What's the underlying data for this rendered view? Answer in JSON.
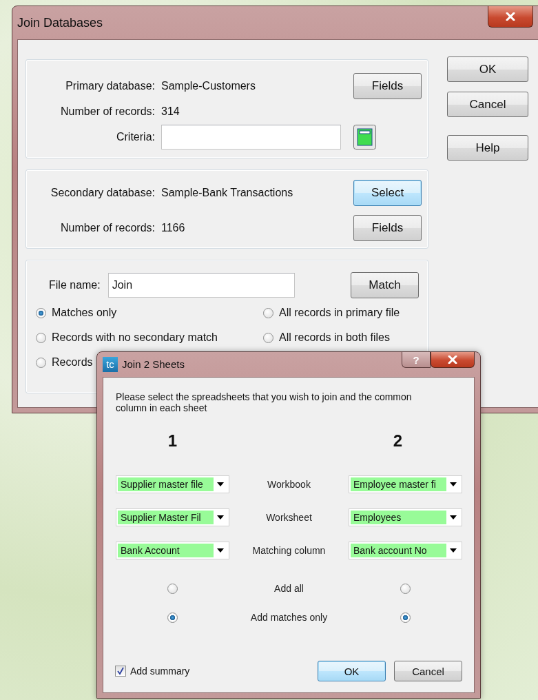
{
  "join_databases": {
    "title": "Join Databases",
    "primary": {
      "label": "Primary database:",
      "value": "Sample-Customers",
      "records_label": "Number of records:",
      "records": "314",
      "fields_button": "Fields",
      "criteria_label": "Criteria:"
    },
    "secondary": {
      "label": "Secondary database:",
      "value": "Sample-Bank Transactions",
      "records_label": "Number of records:",
      "records": "1166",
      "select_button": {
        "label": "Select",
        "focused": true
      },
      "fields_button": {
        "label": "Fields",
        "focused": false
      }
    },
    "file_name": {
      "label": "File name:",
      "value": "Join"
    },
    "match_button": "Match",
    "options": [
      {
        "label": "Matches only",
        "selected": true
      },
      {
        "label": "All records in primary file",
        "selected": false
      },
      {
        "label": "Records with no secondary match",
        "selected": false
      },
      {
        "label": "All records in both files",
        "selected": false
      },
      {
        "label": "Records",
        "selected": false
      }
    ],
    "side_buttons": [
      "OK",
      "Cancel",
      "Help"
    ]
  },
  "join_sheets": {
    "app_icon_text": "tc",
    "title": "Join 2 Sheets",
    "help_button": "?",
    "instruction": "Please select the spreadsheets that you wish to join and the common column in each sheet",
    "columns": [
      "1",
      "2"
    ],
    "rows": [
      {
        "label": "Workbook",
        "left": "Supplier master file",
        "right": "Employee master fi"
      },
      {
        "label": "Worksheet",
        "left": "Supplier Master Fil",
        "right": "Employees"
      },
      {
        "label": "Matching column",
        "left": "Bank Account",
        "right": "Bank account No"
      }
    ],
    "radio_rows": [
      {
        "label": "Add all",
        "left_selected": false,
        "right_selected": false
      },
      {
        "label": "Add matches only",
        "left_selected": true,
        "right_selected": true
      }
    ],
    "add_summary": {
      "label": "Add summary",
      "checked": true
    },
    "buttons": [
      {
        "label": "OK",
        "focused": true
      },
      {
        "label": "Cancel",
        "focused": false
      }
    ]
  }
}
